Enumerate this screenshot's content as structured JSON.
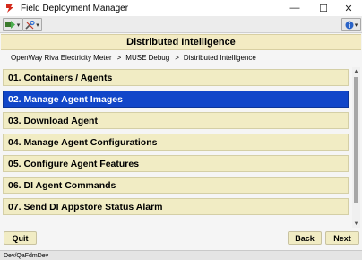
{
  "window": {
    "title": "Field Deployment Manager",
    "minimize_glyph": "—",
    "maximize_glyph": "☐",
    "close_glyph": "✕"
  },
  "toolbar": {
    "nav_icon": "navigate-icon",
    "tools_icon": "tools-icon",
    "help_icon": "info-icon",
    "dropdown_glyph": "▾"
  },
  "header": {
    "title": "Distributed Intelligence"
  },
  "breadcrumb": {
    "items": [
      "OpenWay Riva Electricity Meter",
      "MUSE Debug",
      "Distributed Intelligence"
    ],
    "separator": ">"
  },
  "menu": {
    "items": [
      {
        "label": "01. Containers / Agents",
        "selected": false
      },
      {
        "label": "02. Manage Agent Images",
        "selected": true
      },
      {
        "label": "03. Download Agent",
        "selected": false
      },
      {
        "label": "04. Manage Agent Configurations",
        "selected": false
      },
      {
        "label": "05. Configure Agent Features",
        "selected": false
      },
      {
        "label": "06. DI Agent Commands",
        "selected": false
      },
      {
        "label": "07. Send DI Appstore Status Alarm",
        "selected": false
      }
    ]
  },
  "scrollbar": {
    "up_glyph": "▲",
    "down_glyph": "▼"
  },
  "buttons": {
    "quit": "Quit",
    "back": "Back",
    "next": "Next"
  },
  "status": {
    "text": "Dev/QaFdmDev"
  },
  "colors": {
    "item_bg": "#f1ecc4",
    "selected_bg": "#1146c9",
    "header_bg": "#f3ebc3"
  }
}
